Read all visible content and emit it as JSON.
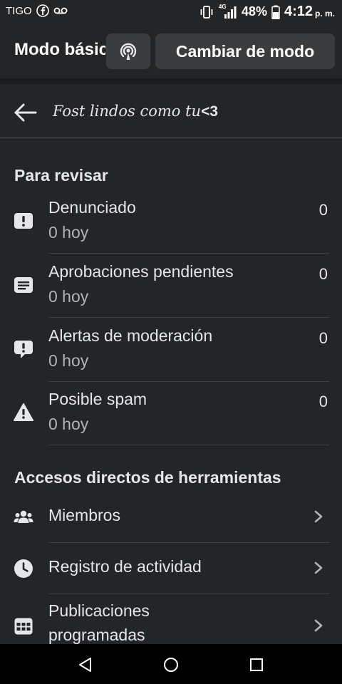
{
  "status_bar": {
    "carrier": "TIGO",
    "network_label": "4G",
    "battery_percent": "48%",
    "time": "4:12",
    "ampm": "p. m."
  },
  "top_bar": {
    "mode_title": "Modo básico",
    "switch_mode_label": "Cambiar de modo",
    "broadcast_icon": "podcast-icon"
  },
  "header": {
    "group_name_styled": "Fost lindos como tu",
    "group_name_tail": "<3"
  },
  "review_section": {
    "title": "Para revisar",
    "items": [
      {
        "label": "Denunciado",
        "sub": "0 hoy",
        "count": "0",
        "icon": "report-icon"
      },
      {
        "label": "Aprobaciones pendientes",
        "sub": "0 hoy",
        "count": "0",
        "icon": "pending-approvals-icon"
      },
      {
        "label": "Alertas de moderación",
        "sub": "0 hoy",
        "count": "0",
        "icon": "moderation-alert-icon"
      },
      {
        "label": "Posible spam",
        "sub": "0 hoy",
        "count": "0",
        "icon": "spam-warning-icon"
      }
    ]
  },
  "tools_section": {
    "title": "Accesos directos de herramientas",
    "items": [
      {
        "label": "Miembros",
        "icon": "members-icon"
      },
      {
        "label": "Registro de actividad",
        "icon": "clock-icon"
      },
      {
        "label": "Publicaciones programadas",
        "icon": "calendar-grid-icon"
      }
    ]
  },
  "colors": {
    "background": "#242526",
    "button_bg": "#3a3b3c",
    "text_primary": "#e4e6eb",
    "text_secondary": "#b0b3b8"
  }
}
